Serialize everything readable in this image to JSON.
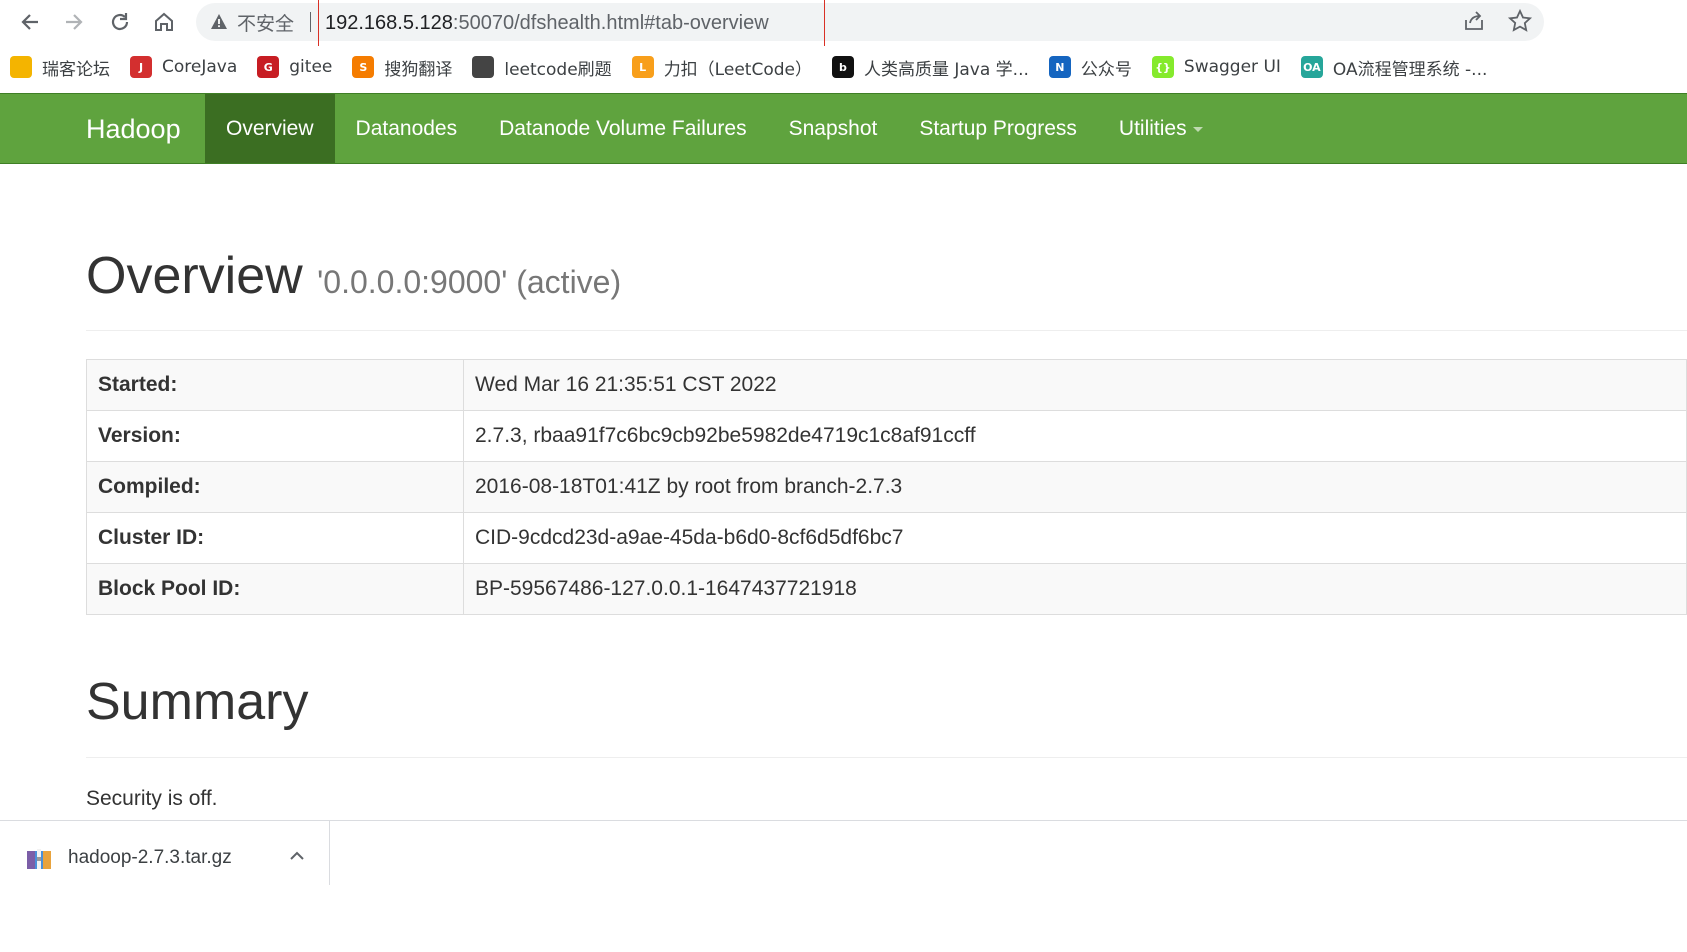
{
  "browser": {
    "insecure_label": "不安全",
    "url_host": "192.168.5.128",
    "url_rest": ":50070/dfshealth.html#tab-overview",
    "bookmarks": [
      {
        "label": "瑞客论坛",
        "icon": "folder-icon",
        "color": "#f4b400"
      },
      {
        "label": "CoreJava",
        "icon": "java-icon",
        "color": "#d32f2f"
      },
      {
        "label": "gitee",
        "icon": "gitee-icon",
        "color": "#c71d23"
      },
      {
        "label": "搜狗翻译",
        "icon": "sogou-icon",
        "color": "#f57c00"
      },
      {
        "label": "leetcode刷题",
        "icon": "book-icon",
        "color": "#444444"
      },
      {
        "label": "力扣（LeetCode）",
        "icon": "leetcode-icon",
        "color": "#f89f1b"
      },
      {
        "label": "人类高质量 Java 学...",
        "icon": "bilibili-icon",
        "color": "#111111"
      },
      {
        "label": "公众号",
        "icon": "n-icon",
        "color": "#1565c0"
      },
      {
        "label": "Swagger UI",
        "icon": "swagger-icon",
        "color": "#85ea2d"
      },
      {
        "label": "OA流程管理系统 -...",
        "icon": "oa-icon",
        "color": "#26a69a"
      }
    ]
  },
  "navbar": {
    "brand": "Hadoop",
    "items": [
      "Overview",
      "Datanodes",
      "Datanode Volume Failures",
      "Snapshot",
      "Startup Progress",
      "Utilities"
    ],
    "active": "Overview",
    "bg_color": "#5fa33e"
  },
  "overview": {
    "title": "Overview",
    "subtitle": "'0.0.0.0:9000' (active)",
    "rows": [
      {
        "key": "Started:",
        "value": "Wed Mar 16 21:35:51 CST 2022"
      },
      {
        "key": "Version:",
        "value": "2.7.3, rbaa91f7c6bc9cb92be5982de4719c1c8af91ccff"
      },
      {
        "key": "Compiled:",
        "value": "2016-08-18T01:41Z by root from branch-2.7.3"
      },
      {
        "key": "Cluster ID:",
        "value": "CID-9cdcd23d-a9ae-45da-b6d0-8cf6d5df6bc7"
      },
      {
        "key": "Block Pool ID:",
        "value": "BP-59567486-127.0.0.1-1647437721918"
      }
    ]
  },
  "summary": {
    "title": "Summary",
    "security": "Security is off."
  },
  "downloads": {
    "file": "hadoop-2.7.3.tar.gz"
  }
}
